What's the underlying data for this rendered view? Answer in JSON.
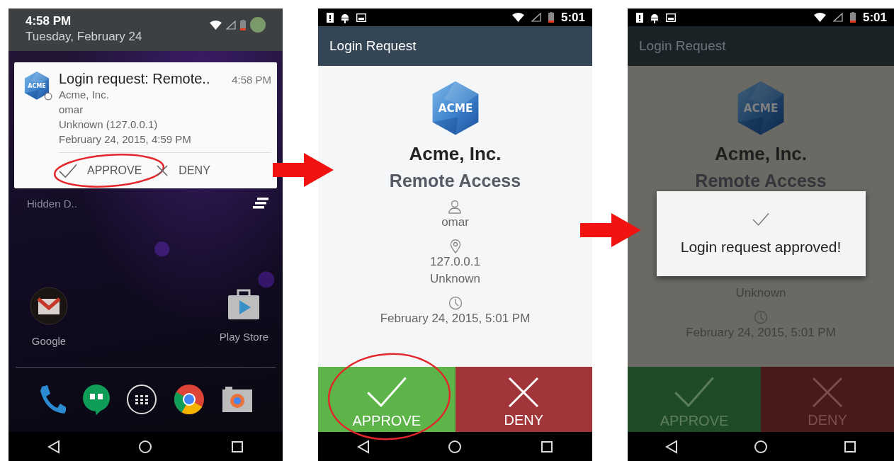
{
  "screens": [
    {
      "kind": "notification_shade",
      "clock": "4:58 PM",
      "date": "Tuesday, February 24",
      "notification": {
        "title": "Login request: Remote..",
        "time": "4:58 PM",
        "logo_text": "ACME",
        "lines": [
          "Acme, Inc.",
          "omar",
          "Unknown (127.0.0.1)",
          "February 24, 2015, 4:59 PM"
        ],
        "actions": [
          {
            "kind": "approve",
            "label": "APPROVE",
            "circled": true
          },
          {
            "kind": "deny",
            "label": "DENY",
            "circled": false
          }
        ]
      },
      "hidden_label": "Hidden D..",
      "apps": [
        {
          "kind": "gmail",
          "label": "Google"
        },
        {
          "kind": "play",
          "label": "Play Store"
        }
      ]
    },
    {
      "kind": "login_request",
      "time": "5:01",
      "title": "Login Request",
      "logo_text": "ACME",
      "company": "Acme, Inc.",
      "service": "Remote Access",
      "dimmed": false,
      "fields": [
        {
          "kind": "user",
          "lines": [
            "omar"
          ]
        },
        {
          "kind": "location",
          "lines": [
            "127.0.0.1",
            "Unknown"
          ]
        },
        {
          "kind": "time",
          "lines": [
            "February 24, 2015, 5:01 PM"
          ]
        }
      ],
      "actions": [
        {
          "kind": "approve",
          "label": "APPROVE",
          "circled": true
        },
        {
          "kind": "deny",
          "label": "DENY",
          "circled": false
        }
      ]
    },
    {
      "kind": "login_request",
      "time": "5:01",
      "title": "Login Request",
      "logo_text": "ACME",
      "company": "Acme, Inc.",
      "service": "Remote Access",
      "dimmed": true,
      "dialog": {
        "message": "Login request approved!"
      },
      "fields": [
        {
          "kind": "plain",
          "lines": [
            "Unknown"
          ]
        },
        {
          "kind": "time",
          "lines": [
            "February 24, 2015, 5:01 PM"
          ]
        }
      ],
      "actions": [
        {
          "kind": "approve",
          "label": "APPROVE",
          "circled": false
        },
        {
          "kind": "deny",
          "label": "DENY",
          "circled": false
        }
      ]
    }
  ]
}
